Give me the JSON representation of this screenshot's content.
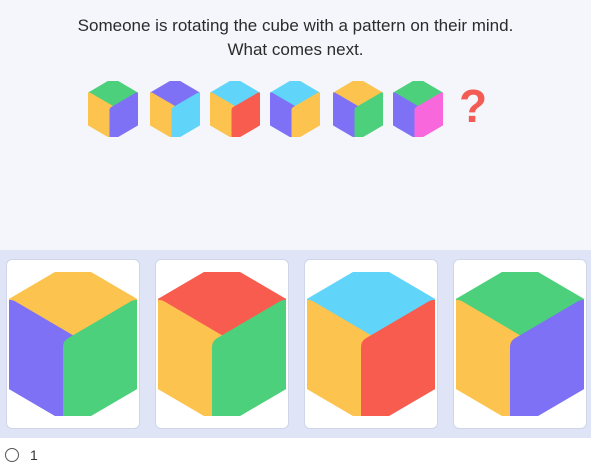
{
  "question": {
    "line1": "Someone is rotating the cube with a pattern on their mind.",
    "line2": "What comes next.",
    "mystery_symbol": "?"
  },
  "colors": {
    "yellow": "#fcc44f",
    "blue": "#60d4f9",
    "red": "#f85c4f",
    "green": "#4cd07b",
    "purple": "#7e71f5",
    "pink": "#f867dc"
  },
  "sequence": [
    {
      "top": "green",
      "left": "yellow",
      "right": "purple"
    },
    {
      "top": "purple",
      "left": "yellow",
      "right": "blue"
    },
    {
      "top": "blue",
      "left": "yellow",
      "right": "red"
    },
    {
      "top": "blue",
      "left": "purple",
      "right": "yellow"
    },
    {
      "top": "yellow",
      "left": "purple",
      "right": "green"
    },
    {
      "top": "green",
      "left": "purple",
      "right": "pink"
    }
  ],
  "options": [
    {
      "top": "yellow",
      "left": "purple",
      "right": "green"
    },
    {
      "top": "red",
      "left": "yellow",
      "right": "green"
    },
    {
      "top": "blue",
      "left": "yellow",
      "right": "red"
    },
    {
      "top": "green",
      "left": "yellow",
      "right": "purple"
    }
  ],
  "footer": {
    "label": "1"
  }
}
